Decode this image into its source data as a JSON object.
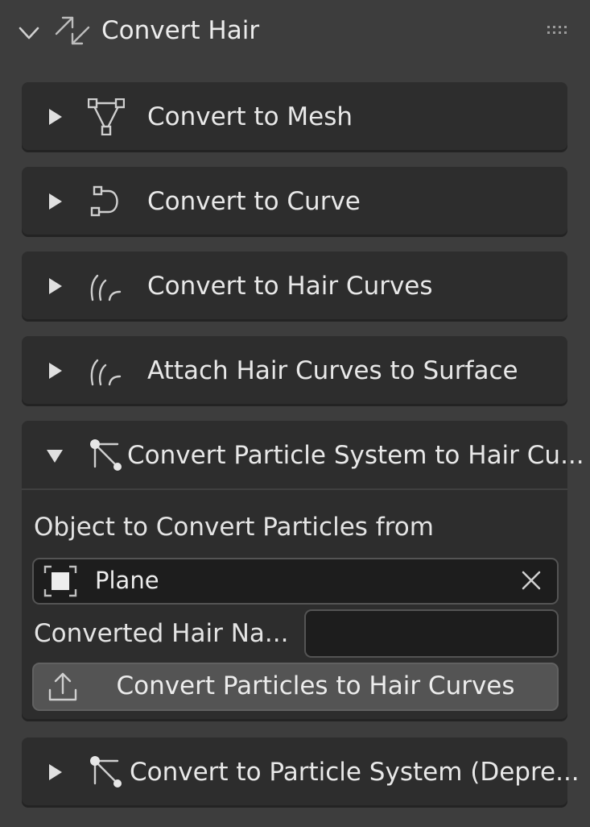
{
  "header": {
    "title": "Convert Hair",
    "icon": "arrows-convert-icon"
  },
  "panels": [
    {
      "label": "Convert to Mesh",
      "icon": "mesh-icon",
      "expanded": false
    },
    {
      "label": "Convert to Curve",
      "icon": "curve-icon",
      "expanded": false
    },
    {
      "label": "Convert to Hair Curves",
      "icon": "hair-curves-icon",
      "expanded": false
    },
    {
      "label": "Attach Hair Curves to Surface",
      "icon": "hair-curves-icon",
      "expanded": false
    },
    {
      "label": "Convert Particle System to Hair Cu...",
      "icon": "particles-icon",
      "expanded": true
    },
    {
      "label": "Convert to Particle System (Depre...",
      "icon": "particles-icon",
      "expanded": false
    }
  ],
  "particle_panel": {
    "object_label": "Object to Convert Particles from",
    "object_value": "Plane",
    "name_label": "Converted Hair Na...",
    "name_value": "",
    "button_label": "Convert Particles to Hair Curves"
  },
  "colors": {
    "background": "#3d3d3d",
    "panel": "#2d2d2d",
    "field": "#1d1d1d",
    "button": "#545454"
  }
}
